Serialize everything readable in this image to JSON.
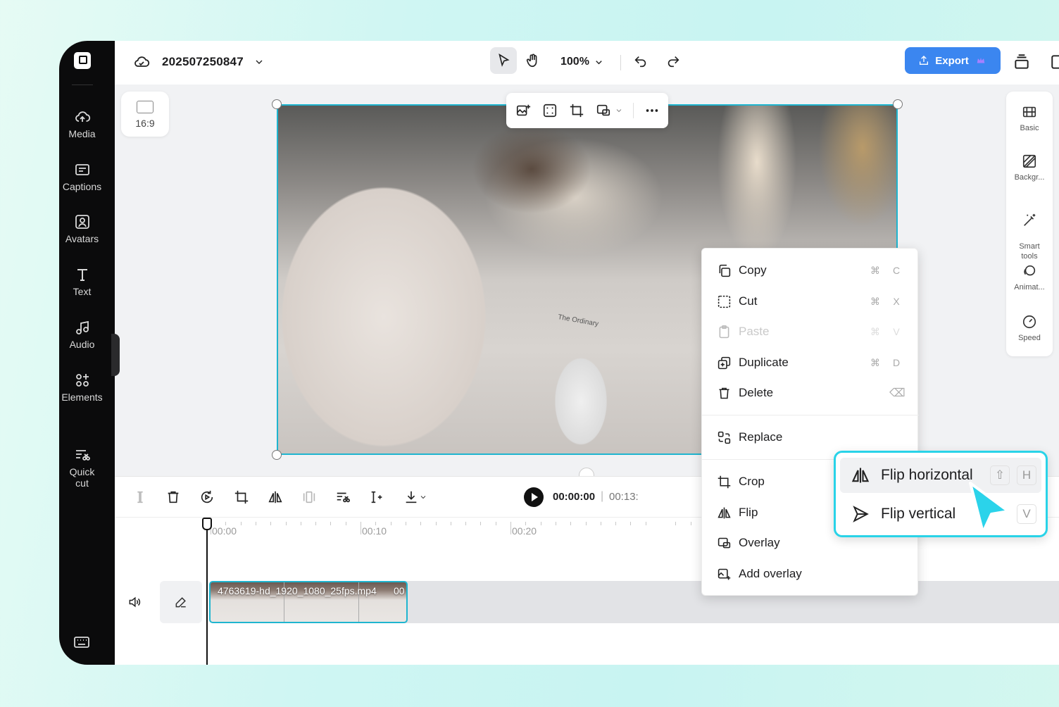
{
  "sidebar": {
    "items": [
      {
        "label": "Media",
        "icon": "cloud-upload-icon"
      },
      {
        "label": "Captions",
        "icon": "captions-icon"
      },
      {
        "label": "Avatars",
        "icon": "avatar-icon"
      },
      {
        "label": "Text",
        "icon": "text-icon"
      },
      {
        "label": "Audio",
        "icon": "music-note-icon"
      },
      {
        "label": "Elements",
        "icon": "elements-icon"
      },
      {
        "label": "Quick\ncut",
        "icon": "quick-cut-icon"
      }
    ]
  },
  "header": {
    "project_name": "202507250847",
    "zoom": "100%",
    "export_label": "Export"
  },
  "canvas": {
    "aspect_ratio": "16:9",
    "photo_text": "The Ordinary"
  },
  "right_panel": {
    "items": [
      {
        "label": "Basic"
      },
      {
        "label": "Backgr..."
      },
      {
        "label": "Smart\ntools"
      },
      {
        "label": "Animat..."
      },
      {
        "label": "Speed"
      }
    ]
  },
  "context_menu": {
    "items": [
      {
        "label": "Copy",
        "mod": "⌘",
        "key": "C",
        "enabled": true
      },
      {
        "label": "Cut",
        "mod": "⌘",
        "key": "X",
        "enabled": true
      },
      {
        "label": "Paste",
        "mod": "⌘",
        "key": "V",
        "enabled": false
      },
      {
        "label": "Duplicate",
        "mod": "⌘",
        "key": "D",
        "enabled": true
      },
      {
        "label": "Delete",
        "key": "⌫",
        "enabled": true
      },
      {
        "label": "Replace",
        "enabled": true
      },
      {
        "label": "Crop",
        "enabled": true
      },
      {
        "label": "Flip",
        "enabled": true
      },
      {
        "label": "Overlay",
        "enabled": true
      },
      {
        "label": "Add overlay",
        "enabled": true
      }
    ]
  },
  "flip_submenu": {
    "horizontal": {
      "label": "Flip horizontal",
      "mod": "⇧",
      "key": "H"
    },
    "vertical": {
      "label": "Flip vertical",
      "key": "V"
    }
  },
  "timeline": {
    "current_time": "00:00:00",
    "total_time": "00:13:",
    "ruler": [
      "00:00",
      "00:10",
      "00:20"
    ],
    "clip_name": "4763619-hd_1920_1080_25fps.mp4",
    "clip_duration_partial": "00"
  },
  "colors": {
    "accent": "#1fb5cf",
    "export": "#3b86f0",
    "submenu_highlight": "#29d3e8"
  }
}
